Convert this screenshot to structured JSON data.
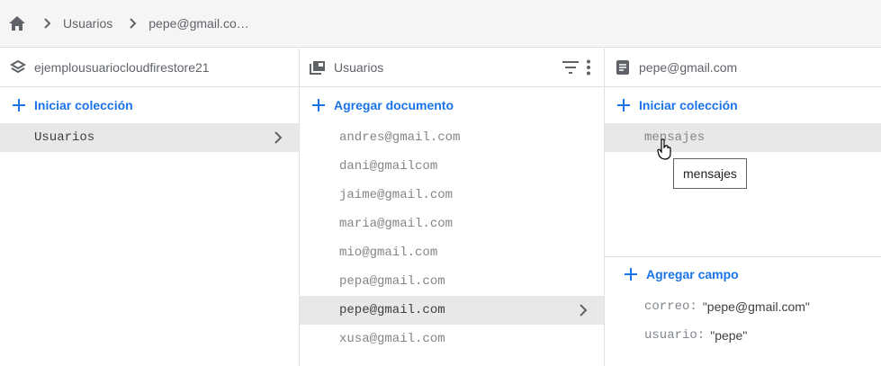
{
  "breadcrumb": {
    "home_icon": "home-icon",
    "items": [
      "Usuarios",
      "pepe@gmail.co…"
    ]
  },
  "columns": {
    "project": {
      "title": "ejemplousuariocloudfirestore21",
      "icon": "firestore-icon",
      "add_label": "Iniciar colección",
      "items": [
        "Usuarios"
      ]
    },
    "collection": {
      "title": "Usuarios",
      "icon": "collection-icon",
      "add_label": "Agregar documento",
      "items": [
        "andres@gmail.com",
        "dani@gmailcom",
        "jaime@gmail.com",
        "maria@gmail.com",
        "mio@gmail.com",
        "pepa@gmail.com",
        "pepe@gmail.com",
        "xusa@gmail.com"
      ],
      "selected": "pepe@gmail.com"
    },
    "document": {
      "title": "pepe@gmail.com",
      "icon": "document-icon",
      "add_collection_label": "Iniciar colección",
      "subcollections": [
        "mensajes"
      ],
      "add_field_label": "Agregar campo",
      "fields": [
        {
          "key": "correo:",
          "value": "\"pepe@gmail.com\""
        },
        {
          "key": "usuario:",
          "value": "\"pepe\""
        }
      ]
    }
  },
  "tooltip": "mensajes",
  "colors": {
    "accent": "#1a73e8",
    "selected_bg": "#e8e8e8",
    "topbar_bg": "#f5f5f5"
  }
}
